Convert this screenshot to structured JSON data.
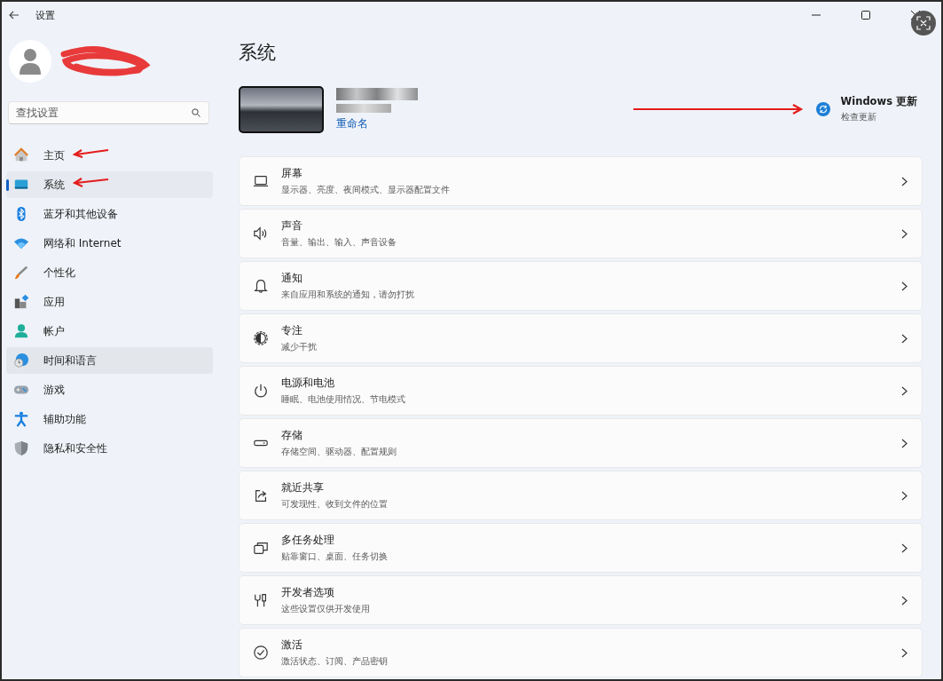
{
  "window": {
    "title": "设置"
  },
  "search": {
    "placeholder": "查找设置"
  },
  "sidebar": {
    "items": [
      {
        "label": "主页",
        "selected": false,
        "hovered": false
      },
      {
        "label": "系统",
        "selected": true,
        "hovered": false
      },
      {
        "label": "蓝牙和其他设备",
        "selected": false,
        "hovered": false
      },
      {
        "label": "网络和 Internet",
        "selected": false,
        "hovered": false
      },
      {
        "label": "个性化",
        "selected": false,
        "hovered": false
      },
      {
        "label": "应用",
        "selected": false,
        "hovered": false
      },
      {
        "label": "帐户",
        "selected": false,
        "hovered": false
      },
      {
        "label": "时间和语言",
        "selected": false,
        "hovered": true
      },
      {
        "label": "游戏",
        "selected": false,
        "hovered": false
      },
      {
        "label": "辅助功能",
        "selected": false,
        "hovered": false
      },
      {
        "label": "隐私和安全性",
        "selected": false,
        "hovered": false
      }
    ]
  },
  "page": {
    "title": "系统",
    "rename_link": "重命名",
    "update": {
      "title": "Windows 更新",
      "subtitle": "检查更新"
    }
  },
  "settings": [
    {
      "title": "屏幕",
      "subtitle": "显示器、亮度、夜间模式、显示器配置文件"
    },
    {
      "title": "声音",
      "subtitle": "音量、输出、输入、声音设备"
    },
    {
      "title": "通知",
      "subtitle": "来自应用和系统的通知，请勿打扰"
    },
    {
      "title": "专注",
      "subtitle": "减少干扰"
    },
    {
      "title": "电源和电池",
      "subtitle": "睡眠、电池使用情况、节电模式"
    },
    {
      "title": "存储",
      "subtitle": "存储空间、驱动器、配置规则"
    },
    {
      "title": "就近共享",
      "subtitle": "可发现性、收到文件的位置"
    },
    {
      "title": "多任务处理",
      "subtitle": "贴靠窗口、桌面、任务切换"
    },
    {
      "title": "开发者选项",
      "subtitle": "这些设置仅供开发使用"
    },
    {
      "title": "激活",
      "subtitle": "激活状态、订阅、产品密钥"
    }
  ]
}
